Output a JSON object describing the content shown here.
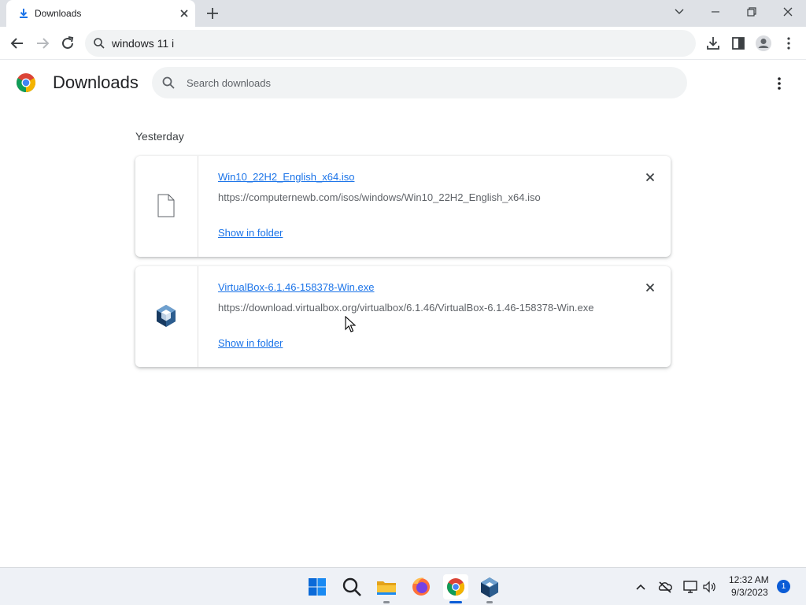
{
  "colors": {
    "accent": "#1a73e8",
    "taskbar_active": "#0b5cd6"
  },
  "tab": {
    "title": "Downloads",
    "favicon": "download-icon"
  },
  "omnibox": {
    "value": "windows 11 i"
  },
  "page": {
    "title": "Downloads",
    "search_placeholder": "Search downloads"
  },
  "section": {
    "label": "Yesterday"
  },
  "downloads": [
    {
      "filename": "Win10_22H2_English_x64.iso",
      "url": "https://computernewb.com/isos/windows/Win10_22H2_English_x64.iso",
      "action": "Show in folder",
      "icon": "file-icon"
    },
    {
      "filename": "VirtualBox-6.1.46-158378-Win.exe",
      "url": "https://download.virtualbox.org/virtualbox/6.1.46/VirtualBox-6.1.46-158378-Win.exe",
      "action": "Show in folder",
      "icon": "virtualbox-icon"
    }
  ],
  "taskbar": {
    "apps": [
      "windows-start-icon",
      "search-icon",
      "file-explorer-icon",
      "firefox-icon",
      "chrome-icon",
      "virtualbox-icon"
    ],
    "clock_time": "12:32 AM",
    "clock_date": "9/3/2023",
    "notification_count": "1"
  }
}
